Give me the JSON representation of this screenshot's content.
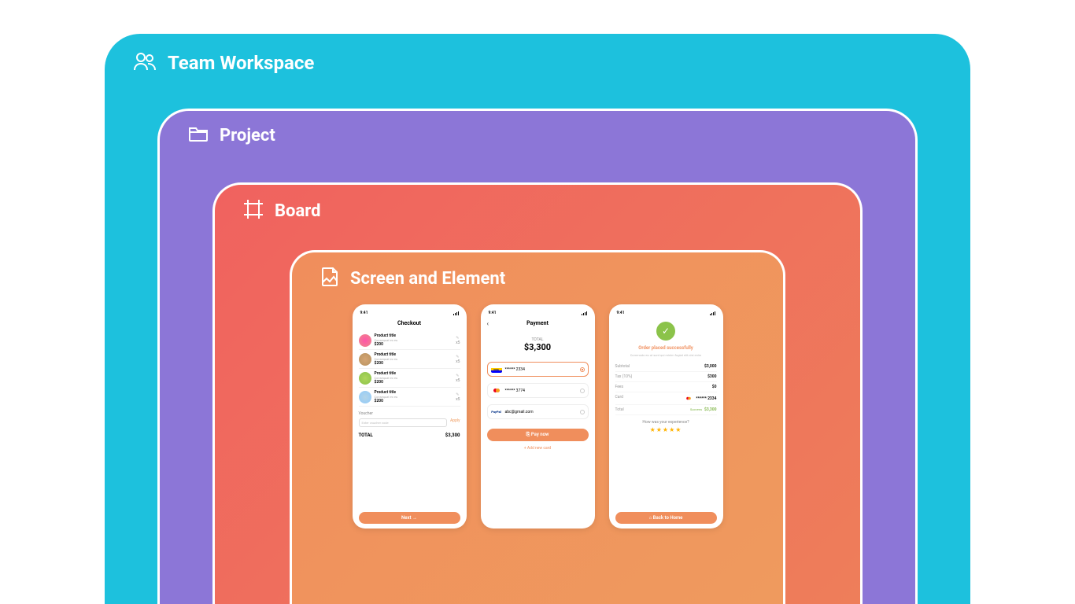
{
  "layers": {
    "workspace": "Team Workspace",
    "project": "Project",
    "board": "Board",
    "screen": "Screen and Element"
  },
  "phone_time": "9:41",
  "screens": {
    "checkout": {
      "title": "Checkout",
      "products": {
        "title": "Product title",
        "subtitle": "Consequat ex eu",
        "price": "$200",
        "qty": "x5"
      },
      "voucher_label": "Voucher",
      "voucher_placeholder": "Enter voucher code",
      "voucher_apply": "Apply",
      "total_label": "TOTAL",
      "total_amount": "$3,300",
      "next_button": "Next →"
    },
    "payment": {
      "title": "Payment",
      "total_label": "TOTAL",
      "total_amount": "$3,300",
      "cards": {
        "visa": "****** 2334",
        "mc": "****** 3774",
        "paypal_label": "PayPal",
        "paypal_email": "abc@gmail.com"
      },
      "pay_button": "⎘ Pay now",
      "add_card": "+ Add new card"
    },
    "success": {
      "title": "Order placed successfully",
      "subtitle": "Commodo eu ut sunt qui minim fugiat elit nisi enim",
      "rows": {
        "subtotal_label": "Subtotal",
        "subtotal_value": "$3,000",
        "tax_label": "Tax (10%)",
        "tax_value": "$300",
        "fees_label": "Fees",
        "fees_value": "$0",
        "card_label": "Card",
        "card_value": "****** 2334",
        "total_label": "Total",
        "total_status": "Success",
        "total_value": "$3,300"
      },
      "experience_label": "How was your experience?",
      "stars": "★★★★★",
      "home_button": "⌂ Back to Home"
    }
  }
}
